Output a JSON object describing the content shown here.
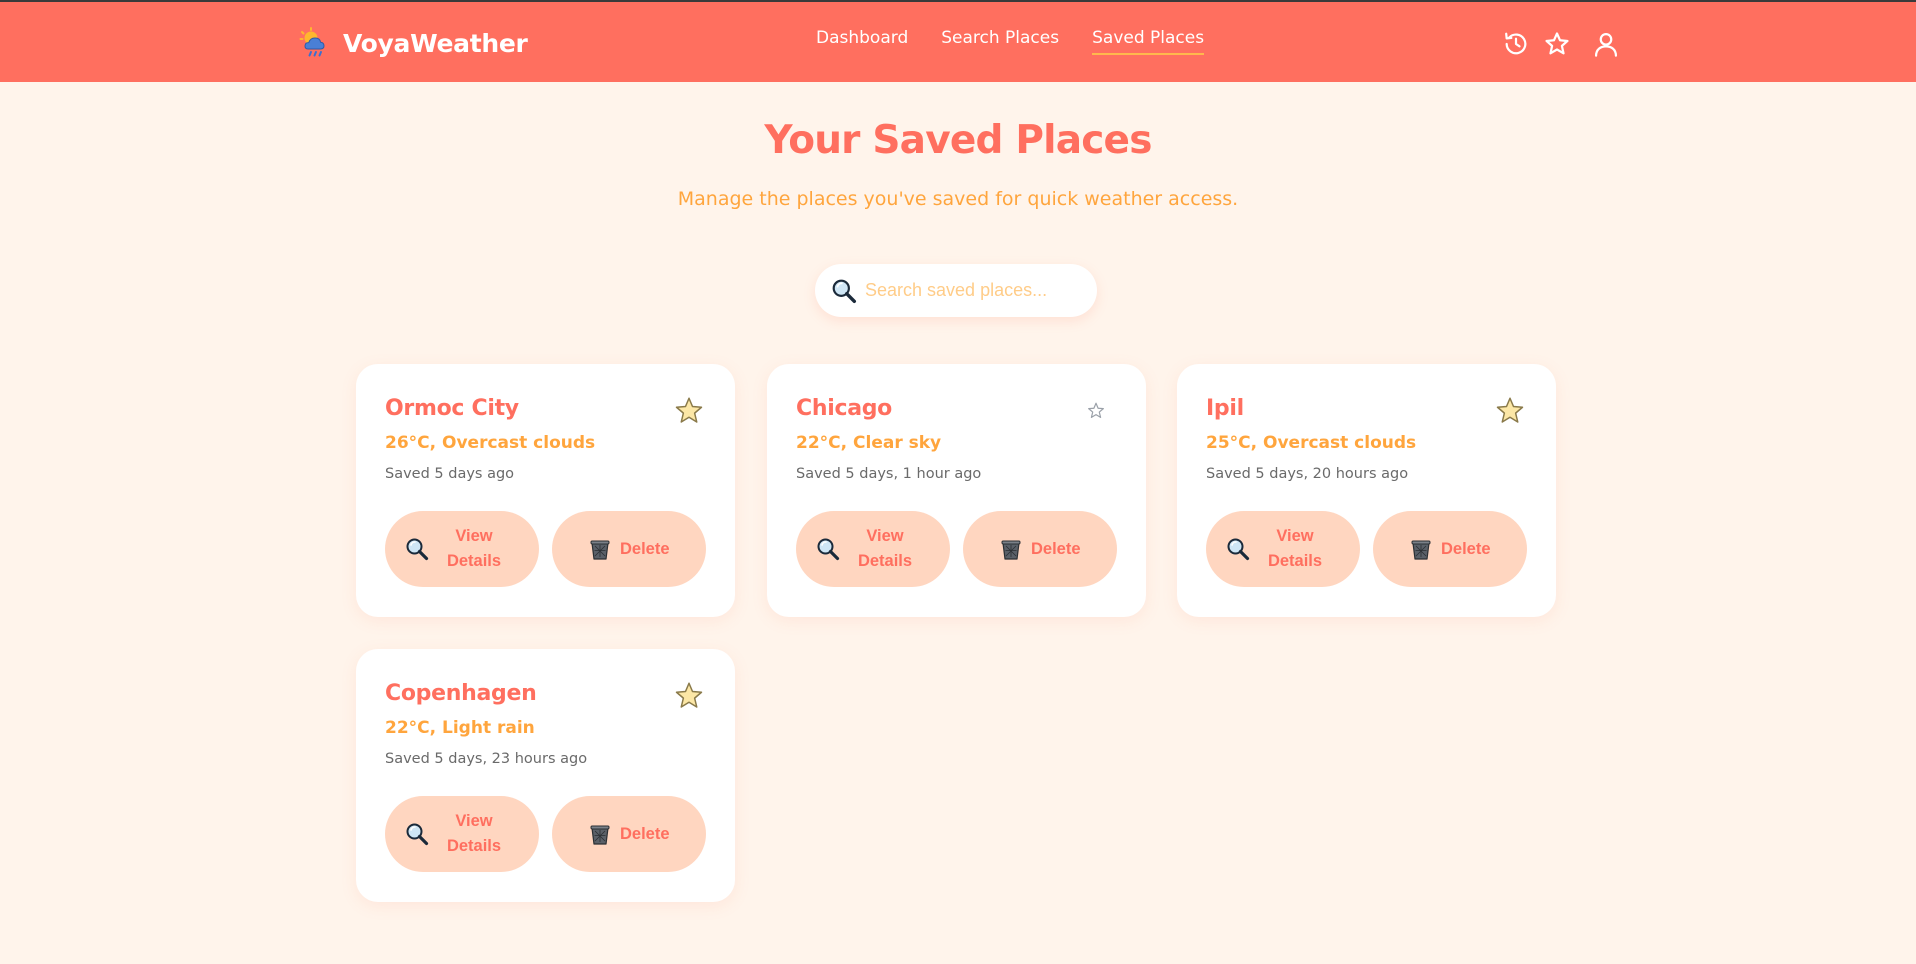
{
  "app": {
    "brand": "VoyaWeather",
    "logo_icon": "sun-cloud-rain-logo-icon"
  },
  "nav": {
    "links": [
      {
        "label": "Dashboard",
        "active": false
      },
      {
        "label": "Search Places",
        "active": false
      },
      {
        "label": "Saved Places",
        "active": true
      }
    ],
    "icons": [
      "history-icon",
      "star-icon",
      "user-icon"
    ]
  },
  "page": {
    "title": "Your Saved Places",
    "subtitle": "Manage the places you've saved for quick weather access."
  },
  "search": {
    "placeholder": "Search saved places...",
    "value": "",
    "icon": "magnifier-icon"
  },
  "cards": [
    {
      "name": "Ormoc City",
      "weather": "26°C, Overcast clouds",
      "saved": "Saved 5 days ago",
      "star_icon": "star-emoji-icon",
      "view_label": "View Details",
      "delete_label": "Delete"
    },
    {
      "name": "Chicago",
      "weather": "22°C, Clear sky",
      "saved": "Saved 5 days, 1 hour ago",
      "star_icon": "star-outline-icon",
      "view_label": "View Details",
      "delete_label": "Delete"
    },
    {
      "name": "Ipil",
      "weather": "25°C, Overcast clouds",
      "saved": "Saved 5 days, 20 hours ago",
      "star_icon": "star-emoji-icon",
      "view_label": "View Details",
      "delete_label": "Delete"
    },
    {
      "name": "Copenhagen",
      "weather": "22°C, Light rain",
      "saved": "Saved 5 days, 23 hours ago",
      "star_icon": "star-emoji-icon",
      "view_label": "View Details",
      "delete_label": "Delete"
    }
  ],
  "colors": {
    "header": "#ff6f5f",
    "background": "#fff4eb",
    "accent": "#ffa53d",
    "button": "#ffd6c0",
    "card": "#ffffff"
  }
}
